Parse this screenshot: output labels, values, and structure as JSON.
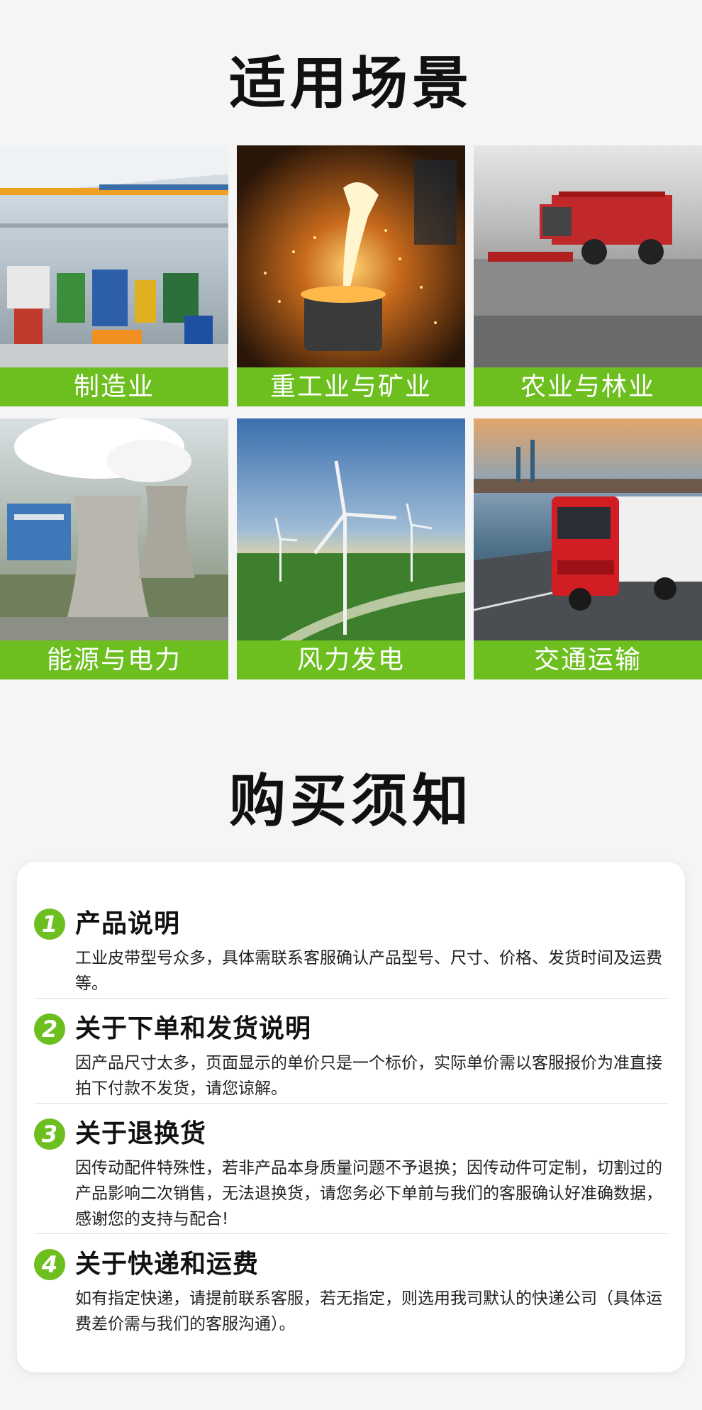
{
  "scenes": {
    "title": "适用场景",
    "tiles": [
      {
        "caption": "制造业"
      },
      {
        "caption": "重工业与矿业"
      },
      {
        "caption": "农业与林业"
      },
      {
        "caption": "能源与电力"
      },
      {
        "caption": "风力发电"
      },
      {
        "caption": "交通运输"
      }
    ]
  },
  "notice": {
    "title": "购买须知",
    "items": [
      {
        "num": "1",
        "title": "产品说明",
        "body": "工业皮带型号众多，具体需联系客服确认产品型号、尺寸、价格、发货时间及运费等。"
      },
      {
        "num": "2",
        "title": "关于下单和发货说明",
        "body": "因产品尺寸太多，页面显示的单价只是一个标价，实际单价需以客服报价为准直接拍下付款不发货，请您谅解。"
      },
      {
        "num": "3",
        "title": "关于退换货",
        "body": "因传动配件特殊性，若非产品本身质量问题不予退换；因传动件可定制，切割过的产品影响二次销售，无法退换货，请您务必下单前与我们的客服确认好准确数据，感谢您的支持与配合!"
      },
      {
        "num": "4",
        "title": "关于快递和运费",
        "body": "如有指定快递，请提前联系客服，若无指定，则选用我司默认的快递公司（具体运费差价需与我们的客服沟通）。"
      }
    ]
  },
  "colors": {
    "accent": "#6cbf1f",
    "background": "#f5f5f5",
    "card": "#ffffff"
  }
}
